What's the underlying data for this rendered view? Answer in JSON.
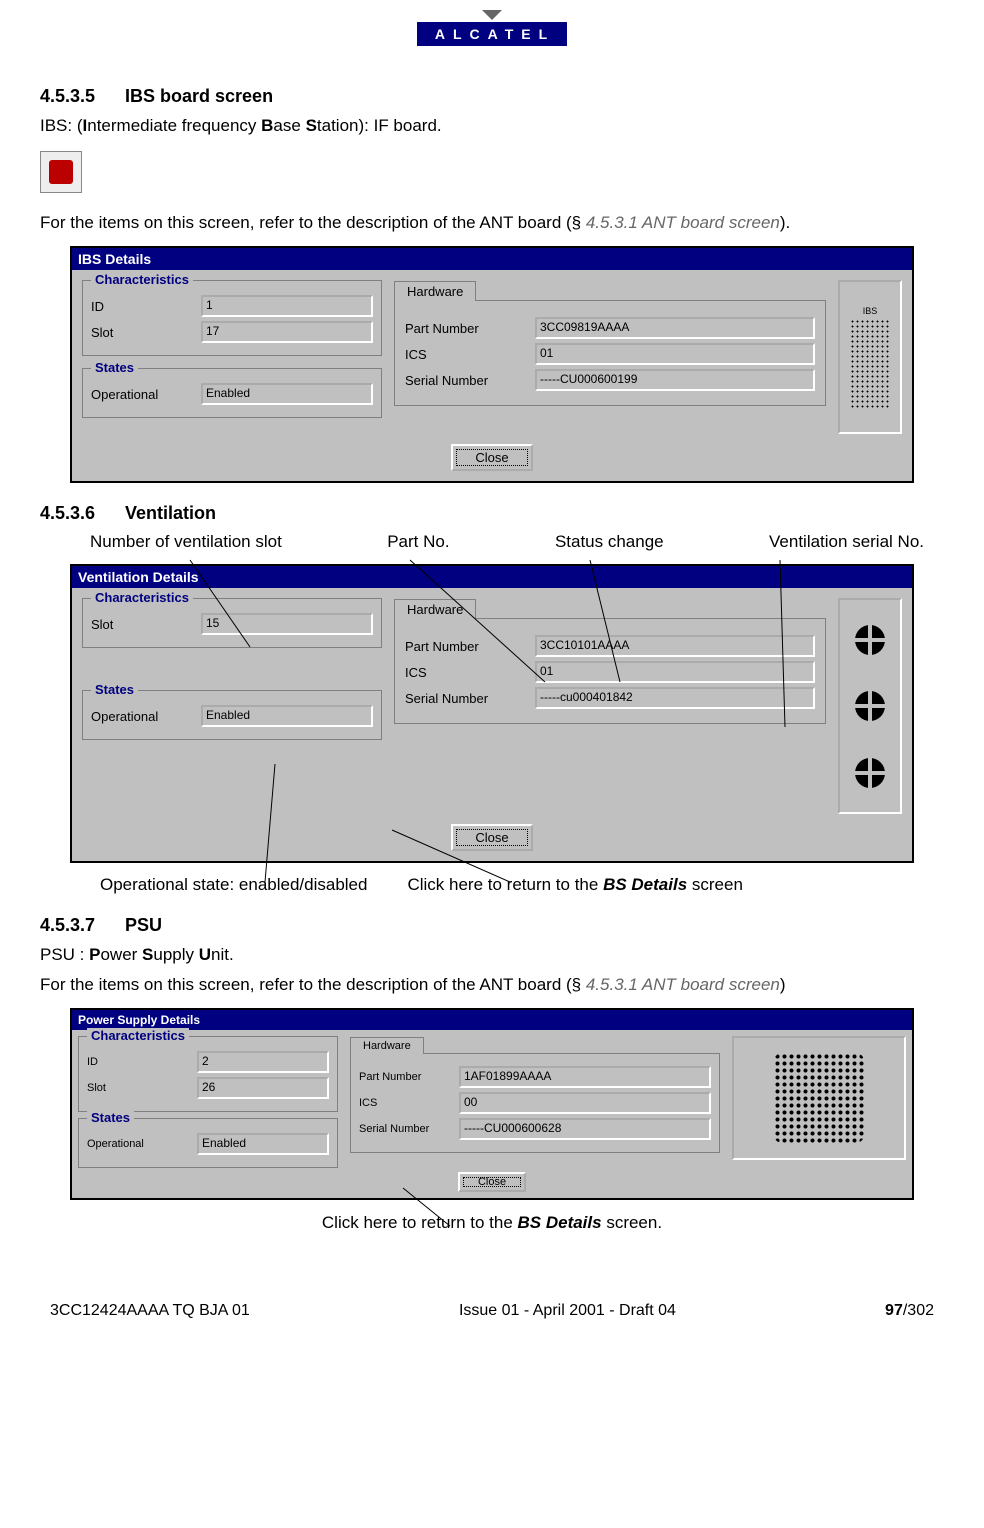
{
  "brand": "ALCATEL",
  "section1": {
    "num": "4.5.3.5",
    "title": "IBS board screen",
    "line1_pre": "IBS: (",
    "line1_b1": "I",
    "line1_mid1": "ntermediate frequency ",
    "line1_b2": "B",
    "line1_mid2": "ase ",
    "line1_b3": "S",
    "line1_post": "tation): IF board.",
    "line2_pre": "For the items on this screen, refer to the description of the ANT board (§ ",
    "line2_ref": "4.5.3.1 ANT board screen",
    "line2_post": ")."
  },
  "ibs": {
    "title": "IBS Details",
    "chars_legend": "Characteristics",
    "id_lbl": "ID",
    "id_val": "1",
    "slot_lbl": "Slot",
    "slot_val": "17",
    "states_legend": "States",
    "op_lbl": "Operational",
    "op_val": "Enabled",
    "hw_tab": "Hardware",
    "pn_lbl": "Part Number",
    "pn_val": "3CC09819AAAA",
    "ics_lbl": "ICS",
    "ics_val": "01",
    "sn_lbl": "Serial Number",
    "sn_val": "-----CU000600199",
    "close": "Close",
    "badge": "IBS"
  },
  "section2": {
    "num": "4.5.3.6",
    "title": "Ventilation",
    "anno_slot": "Number of ventilation slot",
    "anno_pn": "Part No.",
    "anno_status": "Status change",
    "anno_sn": "Ventilation serial No.",
    "anno_op": "Operational state: enabled/disabled",
    "anno_close_pre": "Click here to return to the ",
    "anno_close_bold": "BS Details",
    "anno_close_post": " screen"
  },
  "vent": {
    "title": "Ventilation Details",
    "chars_legend": "Characteristics",
    "slot_lbl": "Slot",
    "slot_val": "15",
    "states_legend": "States",
    "op_lbl": "Operational",
    "op_val": "Enabled",
    "hw_tab": "Hardware",
    "pn_lbl": "Part Number",
    "pn_val": "3CC10101AAAA",
    "ics_lbl": "ICS",
    "ics_val": "01",
    "sn_lbl": "Serial Number",
    "sn_val": "-----cu000401842",
    "close": "Close"
  },
  "section3": {
    "num": "4.5.3.7",
    "title": "PSU",
    "line1_pre": "PSU : ",
    "line1_b1": "P",
    "line1_mid1": "ower ",
    "line1_b2": "S",
    "line1_mid2": "upply ",
    "line1_b3": "U",
    "line1_post": "nit.",
    "line2_pre": "For the items on this screen, refer to the description of the ANT board (§ ",
    "line2_ref": "4.5.3.1 ANT board screen",
    "line2_post": ")",
    "anno_close_pre": "Click here to return to the ",
    "anno_close_bold": "BS Details",
    "anno_close_post": " screen."
  },
  "psu": {
    "title": "Power Supply Details",
    "chars_legend": "Characteristics",
    "id_lbl": "ID",
    "id_val": "2",
    "slot_lbl": "Slot",
    "slot_val": "26",
    "states_legend": "States",
    "op_lbl": "Operational",
    "op_val": "Enabled",
    "hw_tab": "Hardware",
    "pn_lbl": "Part Number",
    "pn_val": "1AF01899AAAA",
    "ics_lbl": "ICS",
    "ics_val": "00",
    "sn_lbl": "Serial Number",
    "sn_val": "-----CU000600628",
    "close": "Close"
  },
  "footer": {
    "left": "3CC12424AAAA TQ BJA 01",
    "center": "Issue 01 - April 2001 - Draft 04",
    "right_bold": "97",
    "right_rest": "/302"
  }
}
